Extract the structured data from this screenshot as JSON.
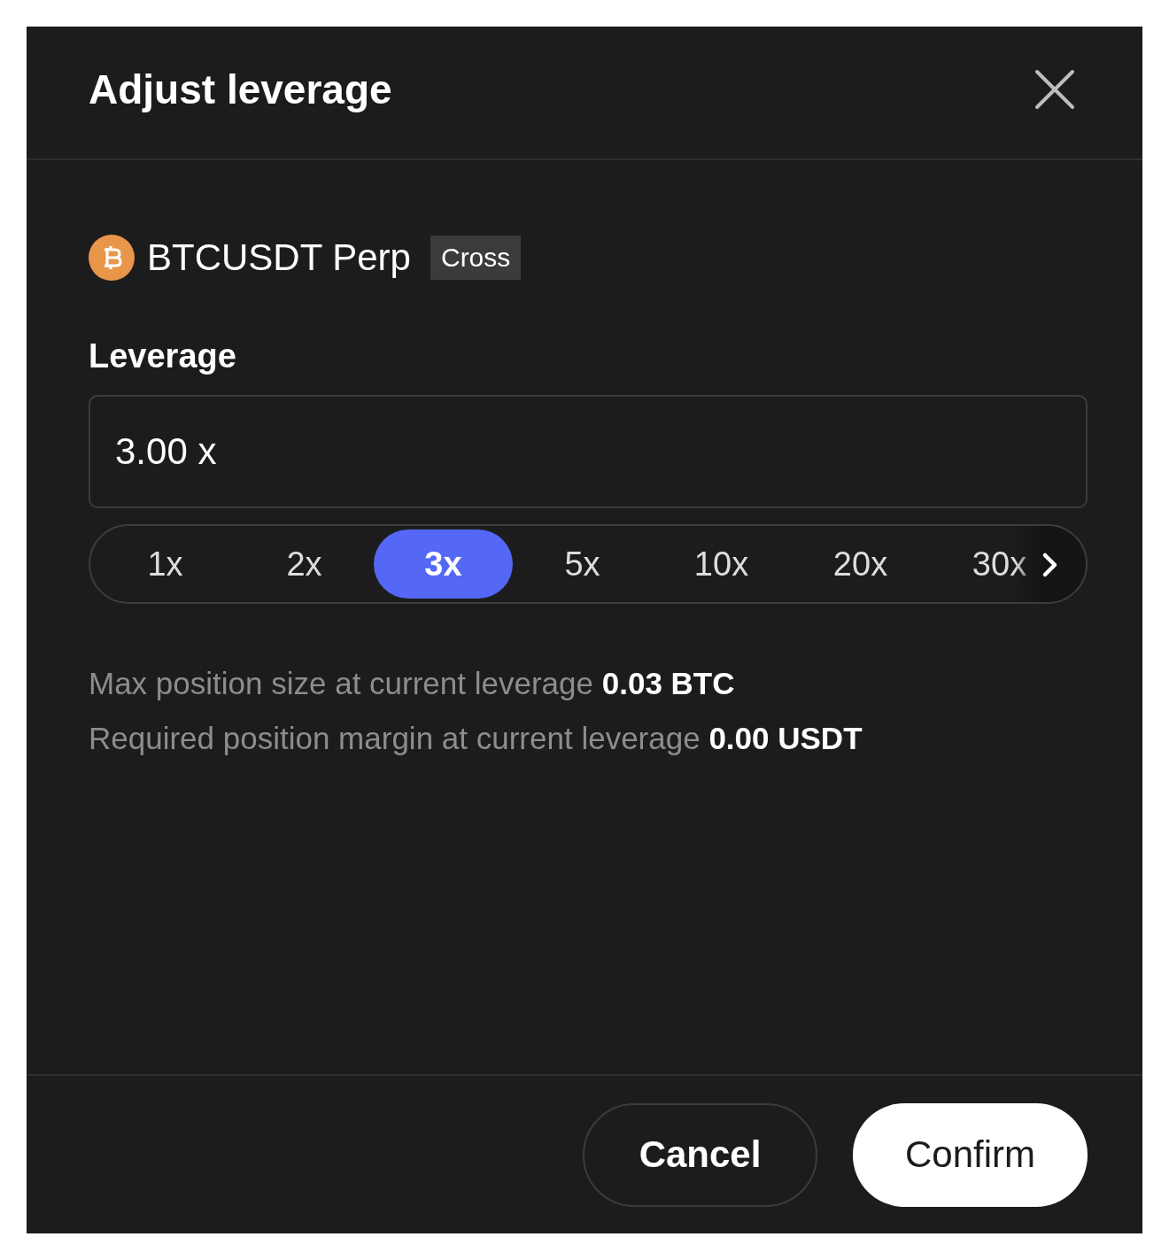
{
  "dialog": {
    "title": "Adjust leverage"
  },
  "instrument": {
    "name": "BTCUSDT Perp",
    "margin_mode": "Cross"
  },
  "leverage": {
    "label": "Leverage",
    "value": "3.00 x"
  },
  "presets": [
    {
      "label": "1x",
      "selected": false
    },
    {
      "label": "2x",
      "selected": false
    },
    {
      "label": "3x",
      "selected": true
    },
    {
      "label": "5x",
      "selected": false
    },
    {
      "label": "10x",
      "selected": false
    },
    {
      "label": "20x",
      "selected": false
    },
    {
      "label": "30x",
      "selected": false
    }
  ],
  "info": [
    {
      "text": "Max position size at current leverage **0.03 BTC**"
    },
    {
      "text": "Required position margin at current leverage **0.00 USDT**"
    }
  ],
  "buttons": [
    {
      "label": "Cancel",
      "kind": "secondary"
    },
    {
      "label": "Confirm",
      "kind": "primary"
    }
  ]
}
